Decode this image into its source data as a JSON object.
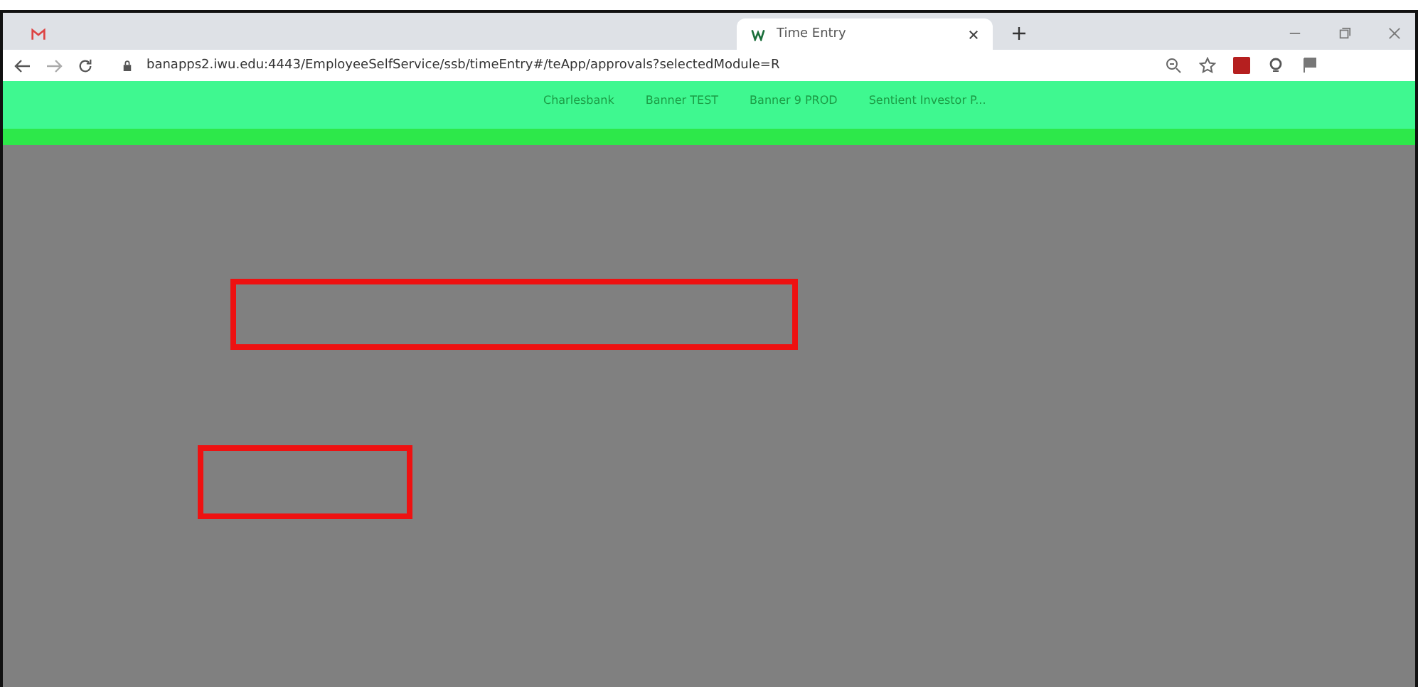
{
  "tabs": [
    {
      "selected": false
    },
    {
      "title": "Time Entry",
      "selected": true
    }
  ],
  "address_bar": {
    "url": "banapps2.iwu.edu:4443/EmployeeSelfService/ssb/timeEntry#/teApp/approvals?selectedModule=R"
  },
  "bookmarks": [
    "Charlesbank",
    "Banner TEST",
    "Banner 9 PROD",
    "Sentient Investor P..."
  ],
  "highlights": [
    {
      "kind": "rectangle"
    },
    {
      "kind": "rectangle"
    }
  ]
}
